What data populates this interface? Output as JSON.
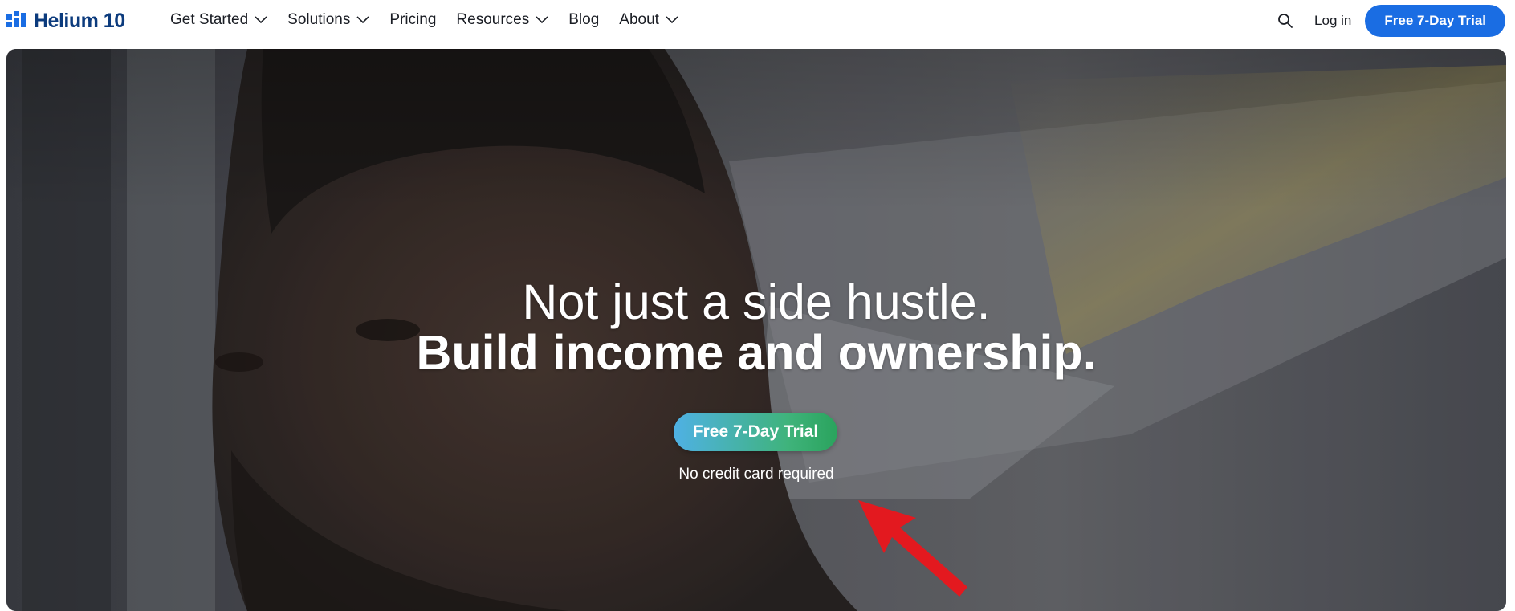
{
  "brand": {
    "name": "Helium 10",
    "icon": "bar-chart-logo-icon",
    "color": "#0c3b7d"
  },
  "nav": {
    "items": [
      {
        "label": "Get Started",
        "has_dropdown": true
      },
      {
        "label": "Solutions",
        "has_dropdown": true
      },
      {
        "label": "Pricing",
        "has_dropdown": false
      },
      {
        "label": "Resources",
        "has_dropdown": true
      },
      {
        "label": "Blog",
        "has_dropdown": false
      },
      {
        "label": "About",
        "has_dropdown": true
      }
    ],
    "search_icon": "search-icon",
    "login_label": "Log in",
    "trial_label": "Free 7-Day Trial",
    "accent_color": "#1a6de3"
  },
  "hero": {
    "headline_line1": "Not just a side hustle.",
    "headline_line2": "Build income and ownership.",
    "cta_label": "Free 7-Day Trial",
    "cta_gradient": [
      "#4fb1e4",
      "#2aa35d"
    ],
    "note": "No credit card required",
    "annotation": "red-arrow-icon",
    "annotation_color": "#e3191f"
  }
}
